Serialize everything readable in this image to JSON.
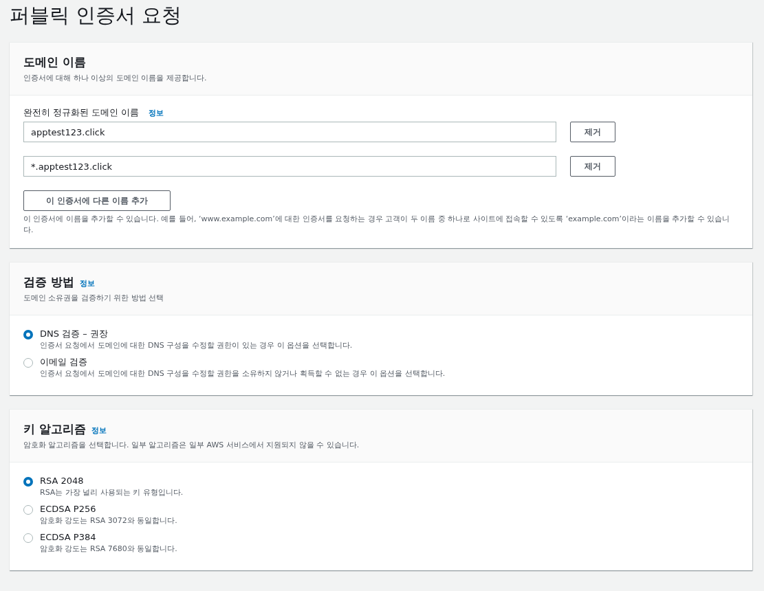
{
  "page_title": "퍼블릭 인증서 요청",
  "domain_section": {
    "title": "도메인 이름",
    "description": "인증서에 대해 하나 이상의 도메인 이름을 제공합니다.",
    "field_label": "완전히 정규화된 도메인 이름",
    "info": "정보",
    "domains": [
      {
        "value": "apptest123.click",
        "remove": "제거"
      },
      {
        "value": "*.apptest123.click",
        "remove": "제거"
      }
    ],
    "add_button": "이 인증서에 다른 이름 추가",
    "hint": "이 인증서에 이름을 추가할 수 있습니다. 예를 들어, ‘www.example.com’에 대한 인증서를 요청하는 경우 고객이 두 이름 중 하나로 사이트에 접속할 수 있도록 ‘example.com’이라는 이름을 추가할 수 있습니다."
  },
  "radio_sections": [
    {
      "title": "검증 방법",
      "info": "정보",
      "description": "도메인 소유권을 검증하기 위한 방법 선택",
      "options": [
        {
          "label": "DNS 검증 – 권장",
          "description": "인증서 요청에서 도메인에 대한 DNS 구성을 수정할 권한이 있는 경우 이 옵션을 선택합니다.",
          "selected": true
        },
        {
          "label": "이메일 검증",
          "description": "인증서 요청에서 도메인에 대한 DNS 구성을 수정할 권한을 소유하지 않거나 획득할 수 없는 경우 이 옵션을 선택합니다.",
          "selected": false
        }
      ]
    },
    {
      "title": "키 알고리즘",
      "info": "정보",
      "description": "암호화 알고리즘을 선택합니다. 일부 알고리즘은 일부 AWS 서비스에서 지원되지 않을 수 있습니다.",
      "options": [
        {
          "label": "RSA 2048",
          "description": "RSA는 가장 널리 사용되는 키 유형입니다.",
          "selected": true
        },
        {
          "label": "ECDSA P256",
          "description": "암호화 강도는 RSA 3072와 동일합니다.",
          "selected": false
        },
        {
          "label": "ECDSA P384",
          "description": "암호화 강도는 RSA 7680와 동일합니다.",
          "selected": false
        }
      ]
    }
  ]
}
